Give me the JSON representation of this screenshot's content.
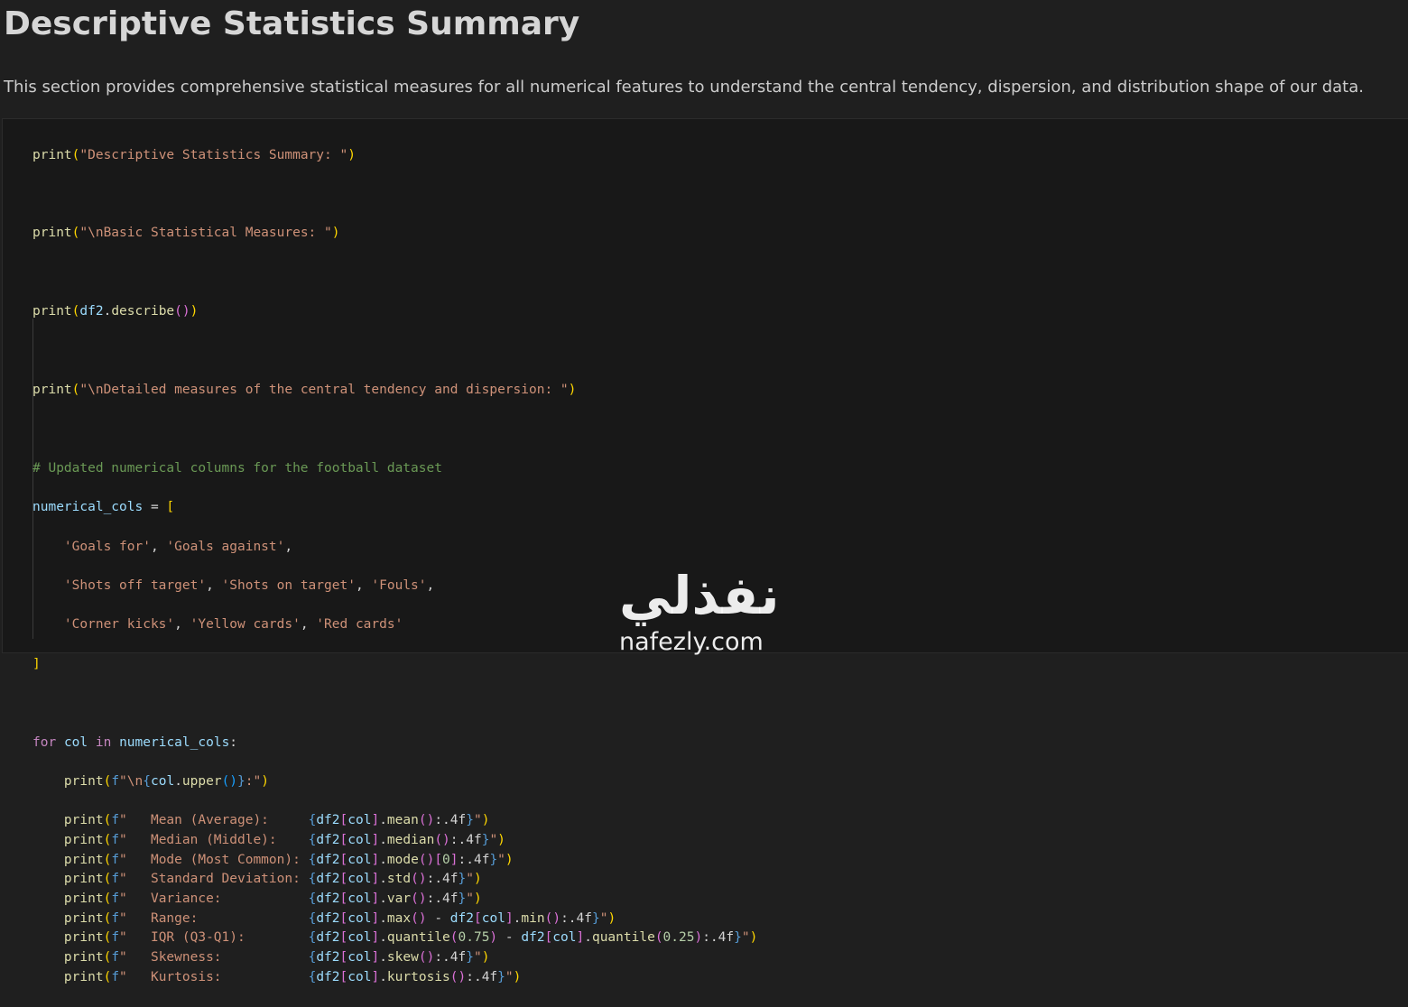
{
  "heading": "Descriptive Statistics Summary",
  "description": "This section provides comprehensive statistical measures for all numerical features to understand the central tendency, dispersion, and distribution shape of our data.",
  "code": {
    "l1_fn": "print",
    "l1_str": "\"Descriptive Statistics Summary: \"",
    "l2_fn": "print",
    "l2_str": "\"\\nBasic Statistical Measures: \"",
    "l3_fn": "print",
    "l3_var": "df2",
    "l3_dot": ".",
    "l3_meth": "describe",
    "l4_fn": "print",
    "l4_str": "\"\\nDetailed measures of the central tendency and dispersion: \"",
    "comment": "# Updated numerical columns for the football dataset",
    "list_var": "numerical_cols",
    "list_items": [
      [
        "'Goals for'",
        "'Goals against'"
      ],
      [
        "'Shots off target'",
        "'Shots on target'",
        "'Fouls'"
      ],
      [
        "'Corner kicks'",
        "'Yellow cards'",
        "'Red cards'"
      ]
    ],
    "for_kw": "for",
    "in_kw": "in",
    "col_var": "col",
    "loop_lines": [
      {
        "label": "   Mean (Average):     ",
        "expr": "mean"
      },
      {
        "label": "   Median (Middle):    ",
        "expr": "median"
      },
      {
        "label": "   Mode (Most Common): ",
        "expr": "mode"
      },
      {
        "label": "   Standard Deviation: ",
        "expr": "std"
      },
      {
        "label": "   Variance:           ",
        "expr": "var"
      },
      {
        "label": "   Range:              ",
        "expr": "range"
      },
      {
        "label": "   IQR (Q3-Q1):        ",
        "expr": "iqr"
      },
      {
        "label": "   Skewness:           ",
        "expr": "skew"
      },
      {
        "label": "   Kurtosis:           ",
        "expr": "kurtosis"
      }
    ]
  },
  "watermark": {
    "arabic": "نفذلي",
    "latin": "nafezly.com"
  }
}
